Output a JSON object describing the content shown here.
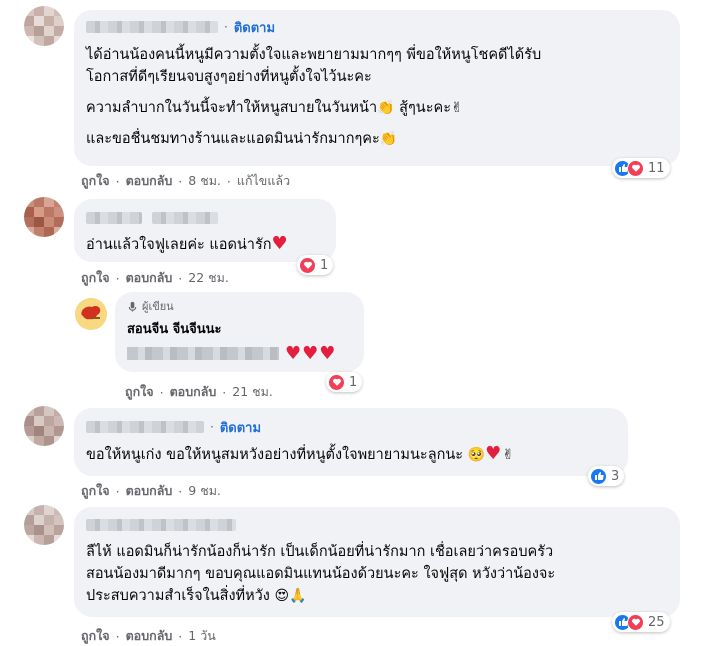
{
  "comments": [
    {
      "follow_label": "ติดตาม",
      "lines": [
        [
          "ได้อ่านน้องคนนี้หนูมีความตั้งใจและพยายามมากๆๆ  พี่ขอให้หนูโชคดีได้รับ",
          "โอกาสที่ดีๆเรียนจบสูงๆอย่างที่หนูตั้งใจไว้นะคะ"
        ],
        [
          "ความลำบากในวันนี้จะทำให้หนูสบายในวันหน้า",
          "สู้ๆนะคะ"
        ],
        [
          "และขอชื่นชมทางร้านและแอดมินน่ารักมากๆคะ"
        ]
      ],
      "actions": {
        "like": "ถูกใจ",
        "reply": "ตอบกลับ",
        "time": "8 ชม.",
        "edited": "แก้ไขแล้ว"
      },
      "reactions": {
        "icons": [
          "like",
          "love"
        ],
        "count": "11"
      }
    },
    {
      "text": "อ่านแล้วใจฟูเลยค่ะ แอดน่ารัก",
      "actions": {
        "like": "ถูกใจ",
        "reply": "ตอบกลับ",
        "time": "22 ชม."
      },
      "reactions": {
        "icons": [
          "love"
        ],
        "count": "1"
      }
    },
    {
      "author_badge": "ผู้เขียน",
      "author_name": "สอนจีน จีนจีนนะ",
      "actions": {
        "like": "ถูกใจ",
        "reply": "ตอบกลับ",
        "time": "21 ชม."
      },
      "reactions": {
        "icons": [
          "love"
        ],
        "count": "1"
      }
    },
    {
      "follow_label": "ติดตาม",
      "text": "ขอให้หนูเก่ง ขอให้หนูสมหวังอย่างที่หนูตั้งใจพยายามนะลูกนะ",
      "actions": {
        "like": "ถูกใจ",
        "reply": "ตอบกลับ",
        "time": "9 ชม."
      },
      "reactions": {
        "icons": [
          "like"
        ],
        "count": "3"
      }
    },
    {
      "lines": [
        "ลืไห้ แอดมินก็น่ารักน้องก็น่ารัก เป็นเด็กน้อยที่น่ารักมาก เชื่อเลยว่าครอบครัว",
        "สอนน้องมาดีมากๆ ขอบคุณแอดมินแทนน้องด้วยนะคะ ใจฟูสุด หวังว่าน้องจะ",
        "ประสบความสำเร็จในสิ่งที่หวัง"
      ],
      "actions": {
        "like": "ถูกใจ",
        "reply": "ตอบกลับ",
        "time": "1 วัน"
      },
      "reactions": {
        "icons": [
          "like",
          "love"
        ],
        "count": "25"
      }
    }
  ],
  "colors": {
    "bubble": "#f0f2f5",
    "follow": "#216fdb",
    "like": "#1877f2",
    "love": "#f33e58",
    "meta": "#65676b"
  }
}
